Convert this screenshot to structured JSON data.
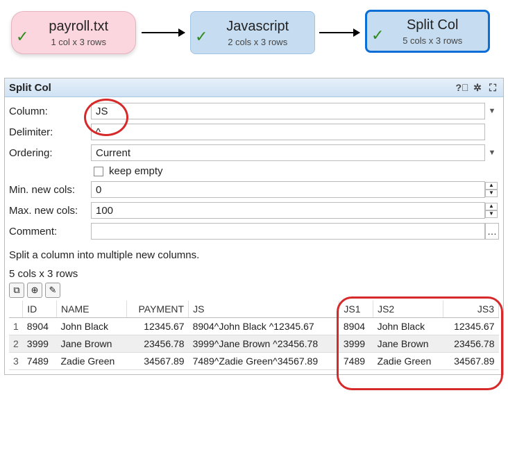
{
  "pipeline": {
    "n1": {
      "title": "payroll.txt",
      "sub": "1 col x 3 rows"
    },
    "n2": {
      "title": "Javascript",
      "sub": "2 cols x 3 rows"
    },
    "n3": {
      "title": "Split Col",
      "sub": "5 cols x 3 rows"
    }
  },
  "panel": {
    "title": "Split Col",
    "labels": {
      "column": "Column:",
      "delimiter": "Delimiter:",
      "ordering": "Ordering:",
      "keep_empty": "keep empty",
      "min_cols": "Min. new cols:",
      "max_cols": "Max. new cols:",
      "comment": "Comment:"
    },
    "values": {
      "column": "JS",
      "delimiter": "^",
      "ordering": "Current",
      "min_cols": "0",
      "max_cols": "100",
      "comment": ""
    },
    "description": "Split a column into multiple new columns.",
    "status": "5 cols x 3 rows"
  },
  "table": {
    "headers": [
      "ID",
      "NAME",
      "PAYMENT",
      "JS",
      "JS1",
      "JS2",
      "JS3"
    ],
    "rows": [
      {
        "idx": "1",
        "id": "8904",
        "name": "John Black",
        "payment": "12345.67",
        "js": "8904^John Black ^12345.67",
        "js1": "8904",
        "js2": "John Black",
        "js3": "12345.67"
      },
      {
        "idx": "2",
        "id": "3999",
        "name": "Jane Brown",
        "payment": "23456.78",
        "js": "3999^Jane Brown ^23456.78",
        "js1": "3999",
        "js2": "Jane Brown",
        "js3": "23456.78"
      },
      {
        "idx": "3",
        "id": "7489",
        "name": "Zadie Green",
        "payment": "34567.89",
        "js": "7489^Zadie Green^34567.89",
        "js1": "7489",
        "js2": "Zadie Green",
        "js3": "34567.89"
      }
    ]
  }
}
